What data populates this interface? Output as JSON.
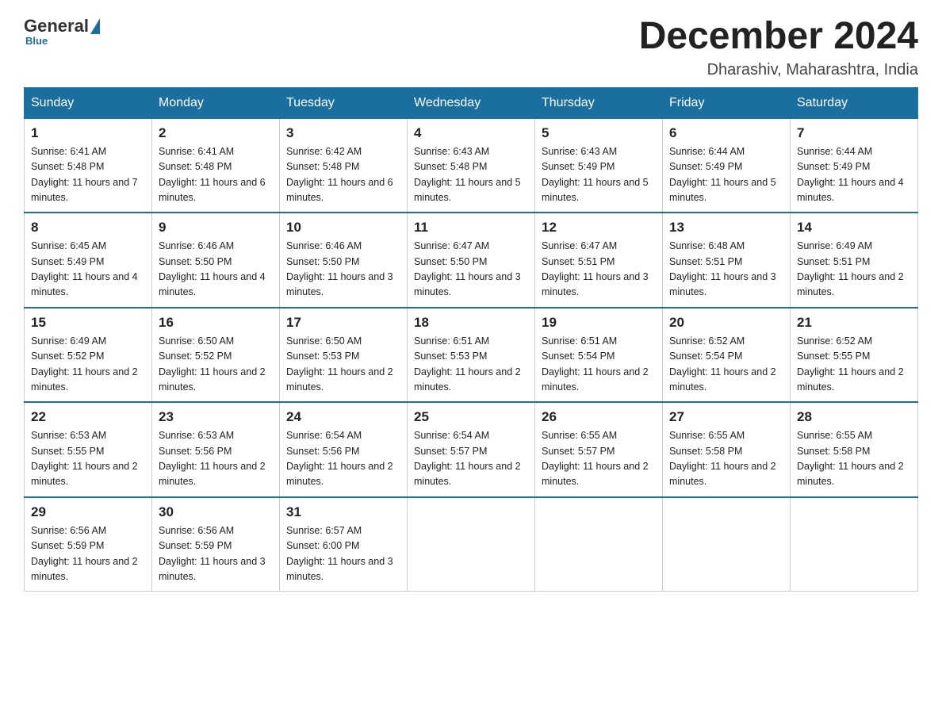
{
  "logo": {
    "general": "General",
    "blue": "Blue",
    "underline": "Blue"
  },
  "header": {
    "title": "December 2024",
    "location": "Dharashiv, Maharashtra, India"
  },
  "days_of_week": [
    "Sunday",
    "Monday",
    "Tuesday",
    "Wednesday",
    "Thursday",
    "Friday",
    "Saturday"
  ],
  "weeks": [
    [
      {
        "num": "1",
        "sunrise": "6:41 AM",
        "sunset": "5:48 PM",
        "daylight": "11 hours and 7 minutes."
      },
      {
        "num": "2",
        "sunrise": "6:41 AM",
        "sunset": "5:48 PM",
        "daylight": "11 hours and 6 minutes."
      },
      {
        "num": "3",
        "sunrise": "6:42 AM",
        "sunset": "5:48 PM",
        "daylight": "11 hours and 6 minutes."
      },
      {
        "num": "4",
        "sunrise": "6:43 AM",
        "sunset": "5:48 PM",
        "daylight": "11 hours and 5 minutes."
      },
      {
        "num": "5",
        "sunrise": "6:43 AM",
        "sunset": "5:49 PM",
        "daylight": "11 hours and 5 minutes."
      },
      {
        "num": "6",
        "sunrise": "6:44 AM",
        "sunset": "5:49 PM",
        "daylight": "11 hours and 5 minutes."
      },
      {
        "num": "7",
        "sunrise": "6:44 AM",
        "sunset": "5:49 PM",
        "daylight": "11 hours and 4 minutes."
      }
    ],
    [
      {
        "num": "8",
        "sunrise": "6:45 AM",
        "sunset": "5:49 PM",
        "daylight": "11 hours and 4 minutes."
      },
      {
        "num": "9",
        "sunrise": "6:46 AM",
        "sunset": "5:50 PM",
        "daylight": "11 hours and 4 minutes."
      },
      {
        "num": "10",
        "sunrise": "6:46 AM",
        "sunset": "5:50 PM",
        "daylight": "11 hours and 3 minutes."
      },
      {
        "num": "11",
        "sunrise": "6:47 AM",
        "sunset": "5:50 PM",
        "daylight": "11 hours and 3 minutes."
      },
      {
        "num": "12",
        "sunrise": "6:47 AM",
        "sunset": "5:51 PM",
        "daylight": "11 hours and 3 minutes."
      },
      {
        "num": "13",
        "sunrise": "6:48 AM",
        "sunset": "5:51 PM",
        "daylight": "11 hours and 3 minutes."
      },
      {
        "num": "14",
        "sunrise": "6:49 AM",
        "sunset": "5:51 PM",
        "daylight": "11 hours and 2 minutes."
      }
    ],
    [
      {
        "num": "15",
        "sunrise": "6:49 AM",
        "sunset": "5:52 PM",
        "daylight": "11 hours and 2 minutes."
      },
      {
        "num": "16",
        "sunrise": "6:50 AM",
        "sunset": "5:52 PM",
        "daylight": "11 hours and 2 minutes."
      },
      {
        "num": "17",
        "sunrise": "6:50 AM",
        "sunset": "5:53 PM",
        "daylight": "11 hours and 2 minutes."
      },
      {
        "num": "18",
        "sunrise": "6:51 AM",
        "sunset": "5:53 PM",
        "daylight": "11 hours and 2 minutes."
      },
      {
        "num": "19",
        "sunrise": "6:51 AM",
        "sunset": "5:54 PM",
        "daylight": "11 hours and 2 minutes."
      },
      {
        "num": "20",
        "sunrise": "6:52 AM",
        "sunset": "5:54 PM",
        "daylight": "11 hours and 2 minutes."
      },
      {
        "num": "21",
        "sunrise": "6:52 AM",
        "sunset": "5:55 PM",
        "daylight": "11 hours and 2 minutes."
      }
    ],
    [
      {
        "num": "22",
        "sunrise": "6:53 AM",
        "sunset": "5:55 PM",
        "daylight": "11 hours and 2 minutes."
      },
      {
        "num": "23",
        "sunrise": "6:53 AM",
        "sunset": "5:56 PM",
        "daylight": "11 hours and 2 minutes."
      },
      {
        "num": "24",
        "sunrise": "6:54 AM",
        "sunset": "5:56 PM",
        "daylight": "11 hours and 2 minutes."
      },
      {
        "num": "25",
        "sunrise": "6:54 AM",
        "sunset": "5:57 PM",
        "daylight": "11 hours and 2 minutes."
      },
      {
        "num": "26",
        "sunrise": "6:55 AM",
        "sunset": "5:57 PM",
        "daylight": "11 hours and 2 minutes."
      },
      {
        "num": "27",
        "sunrise": "6:55 AM",
        "sunset": "5:58 PM",
        "daylight": "11 hours and 2 minutes."
      },
      {
        "num": "28",
        "sunrise": "6:55 AM",
        "sunset": "5:58 PM",
        "daylight": "11 hours and 2 minutes."
      }
    ],
    [
      {
        "num": "29",
        "sunrise": "6:56 AM",
        "sunset": "5:59 PM",
        "daylight": "11 hours and 2 minutes."
      },
      {
        "num": "30",
        "sunrise": "6:56 AM",
        "sunset": "5:59 PM",
        "daylight": "11 hours and 3 minutes."
      },
      {
        "num": "31",
        "sunrise": "6:57 AM",
        "sunset": "6:00 PM",
        "daylight": "11 hours and 3 minutes."
      },
      null,
      null,
      null,
      null
    ]
  ]
}
